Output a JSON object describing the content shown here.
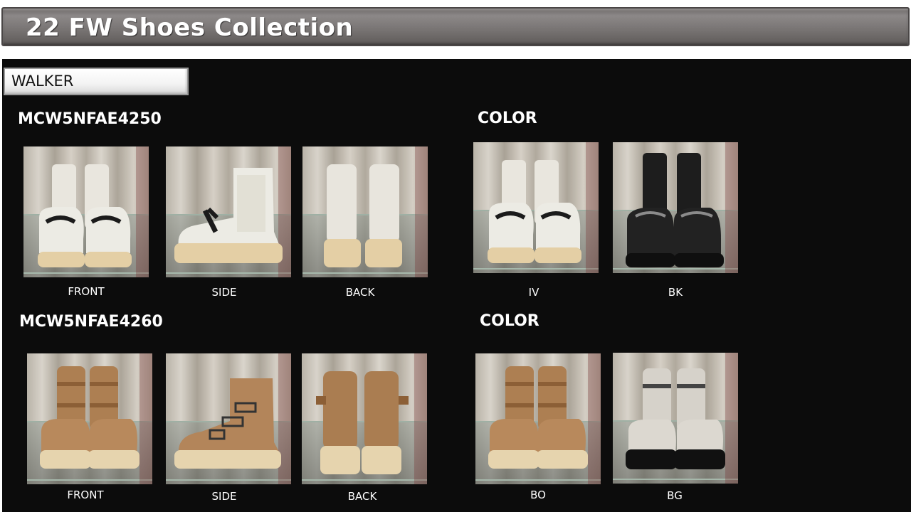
{
  "header": {
    "title": "22 FW Shoes Collection"
  },
  "category": {
    "label": "WALKER"
  },
  "products": [
    {
      "code": "MCW5NFAE4250",
      "color_heading": "COLOR",
      "views": [
        {
          "label": "FRONT",
          "shoe": "ivory-chain-front"
        },
        {
          "label": "SIDE",
          "shoe": "ivory-chain-side"
        },
        {
          "label": "BACK",
          "shoe": "ivory-back"
        }
      ],
      "colors": [
        {
          "label": "IV",
          "shoe": "ivory-chain-front"
        },
        {
          "label": "BK",
          "shoe": "black-chain-front"
        }
      ]
    },
    {
      "code": "MCW5NFAE4260",
      "color_heading": "COLOR",
      "views": [
        {
          "label": "FRONT",
          "shoe": "tan-buckle-front"
        },
        {
          "label": "SIDE",
          "shoe": "tan-buckle-side"
        },
        {
          "label": "BACK",
          "shoe": "tan-buckle-back"
        }
      ],
      "colors": [
        {
          "label": "BO",
          "shoe": "tan-buckle-front"
        },
        {
          "label": "BG",
          "shoe": "grey-buckle-front"
        }
      ]
    }
  ],
  "palette": {
    "header_bar": "#7a7675",
    "panel_bg": "#0c0c0c",
    "curtain": "#c9c3b8",
    "ivory": "#ece9e2",
    "black": "#1a1a1a",
    "tan": "#b6895b",
    "grey": "#d3cfc8",
    "sole": "#e6d3ad"
  }
}
